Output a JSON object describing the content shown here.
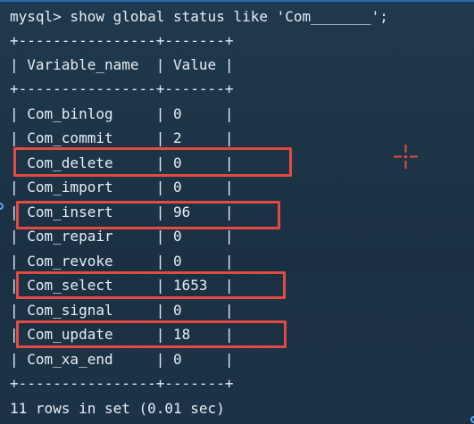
{
  "terminal": {
    "command": "mysql> show global status like 'Com_______';",
    "separator": "+----------------+-------+",
    "header": "| Variable_name  | Value |",
    "rows": [
      "| Com_binlog     | 0     |",
      "| Com_commit     | 2     |",
      "| Com_delete     | 0     |",
      "| Com_import     | 0     |",
      "| Com_insert     | 96    |",
      "| Com_repair     | 0     |",
      "| Com_revoke     | 0     |",
      "| Com_select     | 1653  |",
      "| Com_signal     | 0     |",
      "| Com_update     | 18    |",
      "| Com_xa_end     | 0     |"
    ],
    "footer": "11 rows in set (0.01 sec)"
  },
  "colors": {
    "background": "#1f3447",
    "text": "#e6eef6",
    "highlight": "#e34a43"
  },
  "icons": {
    "crosshair": "crosshair-icon"
  }
}
